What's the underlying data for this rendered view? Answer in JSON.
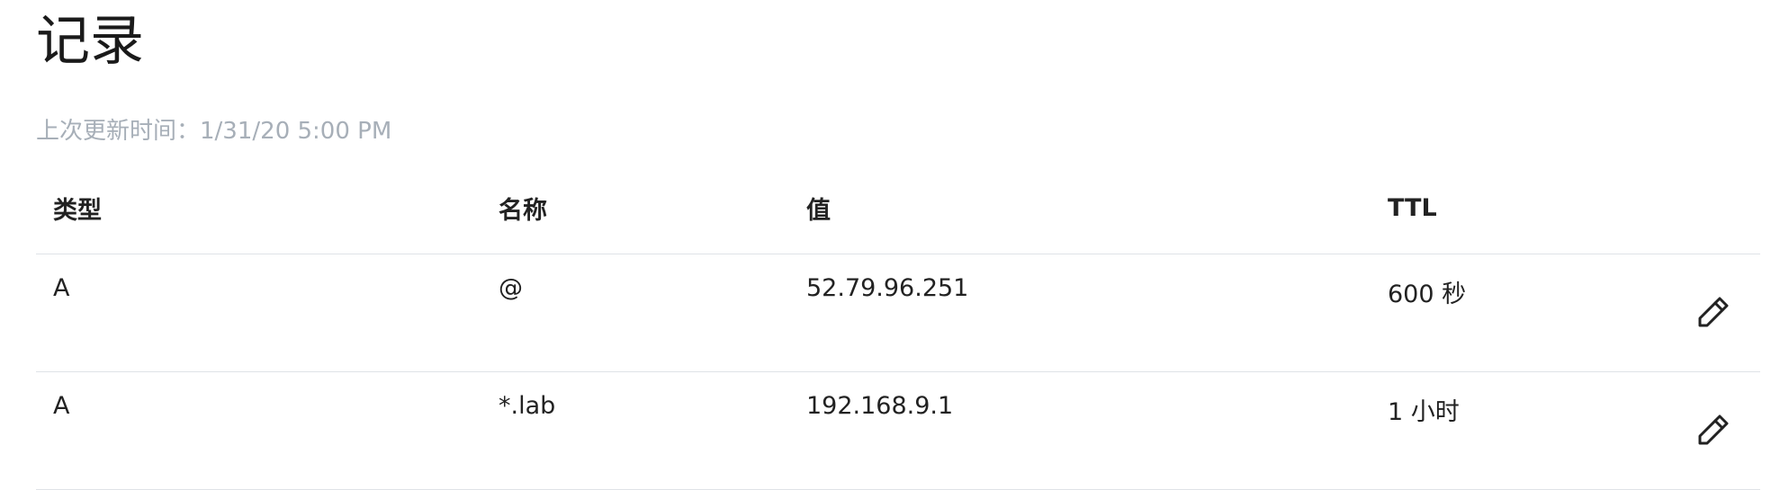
{
  "header": {
    "title": "记录",
    "last_updated": "上次更新时间：1/31/20 5:00 PM"
  },
  "table": {
    "columns": [
      "类型",
      "名称",
      "值",
      "TTL"
    ],
    "rows": [
      {
        "type": "A",
        "name": "@",
        "value": "52.79.96.251",
        "ttl": "600 秒",
        "action_icon": "pencil-icon"
      },
      {
        "type": "A",
        "name": "*.lab",
        "value": "192.168.9.1",
        "ttl": "1 小时",
        "action_icon": "pencil-icon"
      }
    ]
  },
  "colors": {
    "text": "#222222",
    "muted": "#a7afb8",
    "divider": "#dfe3e7",
    "background": "#ffffff"
  }
}
